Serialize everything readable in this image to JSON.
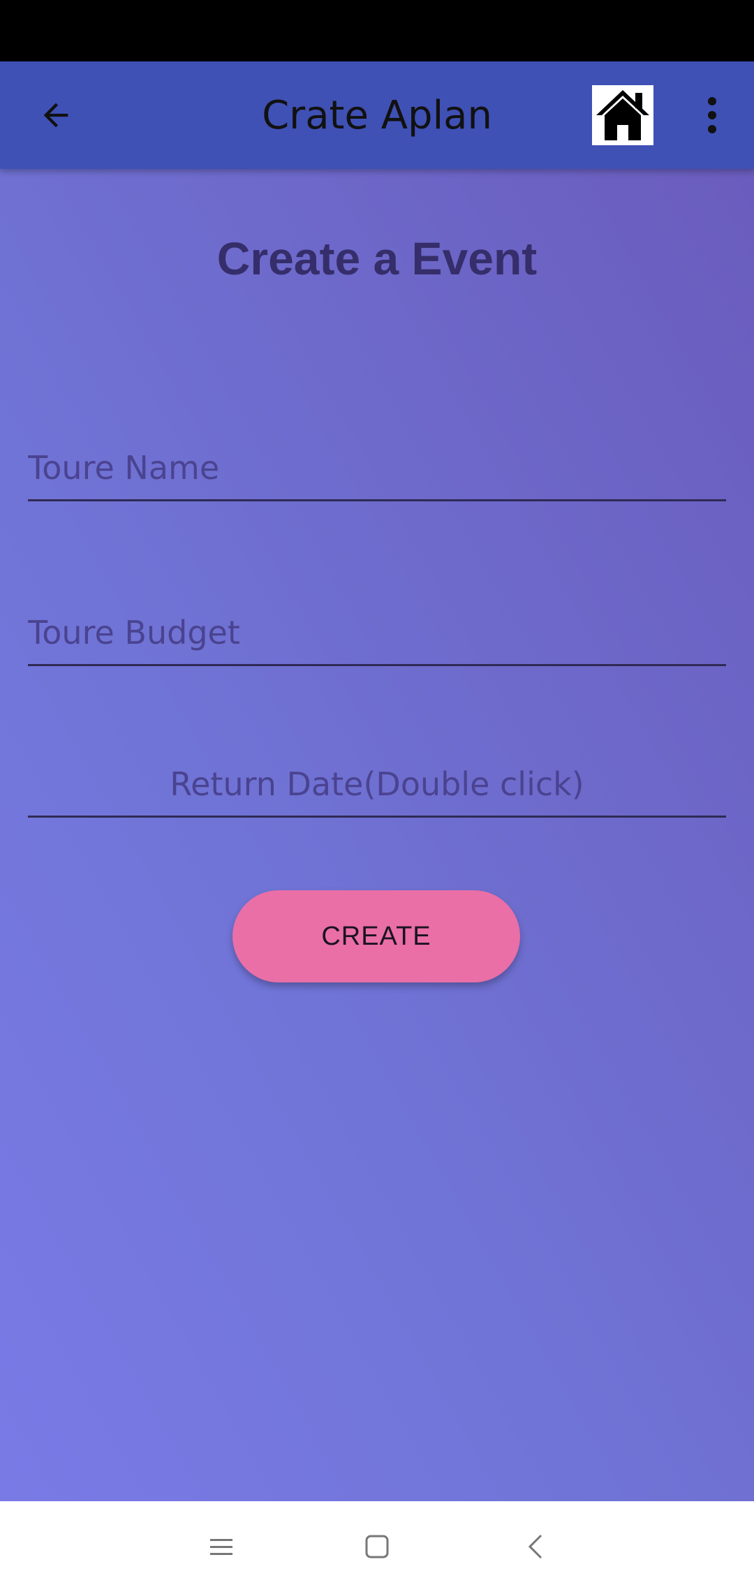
{
  "app_bar": {
    "title": "Crate Aplan",
    "back_icon": "arrow-left-icon",
    "home_icon": "home-icon",
    "overflow_icon": "more-vert-icon"
  },
  "form": {
    "heading": "Create a Event",
    "tour_name": {
      "placeholder": "Toure Name",
      "value": ""
    },
    "tour_budget": {
      "placeholder": "Toure Budget",
      "value": ""
    },
    "return_date": {
      "placeholder": "Return Date(Double click)",
      "value": ""
    },
    "create_label": "CREATE"
  },
  "colors": {
    "app_bar": "#3f51b5",
    "button": "#e96fa6",
    "heading": "#352e6a"
  },
  "nav_bar": {
    "menu_icon": "menu-icon",
    "home_icon": "square-home-icon",
    "back_icon": "chevron-left-icon"
  }
}
